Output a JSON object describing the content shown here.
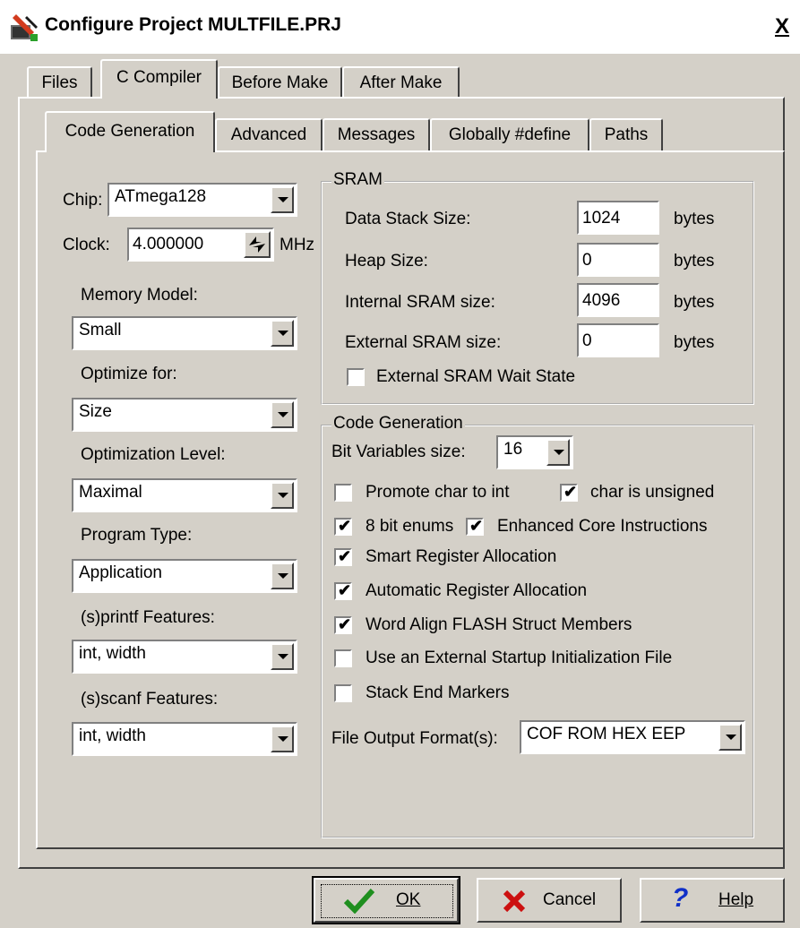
{
  "window": {
    "title": "Configure Project MULTFILE.PRJ",
    "close": "X"
  },
  "tabs": [
    "Files",
    "C Compiler",
    "Before Make",
    "After Make"
  ],
  "subtabs": [
    "Code Generation",
    "Advanced",
    "Messages",
    "Globally #define",
    "Paths"
  ],
  "left": {
    "chip_label": "Chip:",
    "chip_value": "ATmega128",
    "clock_label": "Clock:",
    "clock_value": "4.000000",
    "clock_unit": "MHz",
    "memory_model_label": "Memory Model:",
    "memory_model_value": "Small",
    "optimize_label": "Optimize for:",
    "optimize_value": "Size",
    "opt_level_label": "Optimization Level:",
    "opt_level_value": "Maximal",
    "program_type_label": "Program Type:",
    "program_type_value": "Application",
    "printf_label": "(s)printf Features:",
    "printf_value": "int, width",
    "scanf_label": "(s)scanf Features:",
    "scanf_value": "int, width"
  },
  "sram": {
    "title": "SRAM",
    "rows": [
      {
        "label": "Data Stack Size:",
        "value": "1024",
        "unit": "bytes"
      },
      {
        "label": "Heap Size:",
        "value": "0",
        "unit": "bytes"
      },
      {
        "label": "Internal SRAM size:",
        "value": "4096",
        "unit": "bytes"
      },
      {
        "label": "External SRAM size:",
        "value": "0",
        "unit": "bytes"
      }
    ],
    "wait_state": {
      "label": "External SRAM Wait State",
      "checked": false
    }
  },
  "codegen": {
    "title": "Code Generation",
    "bitvar_label": "Bit Variables size:",
    "bitvar_value": "16",
    "promote_label": "Promote char to int",
    "promote_checked": false,
    "unsigned_label": "char is unsigned",
    "unsigned_checked": true,
    "enums_label": "8 bit enums",
    "enums_checked": true,
    "enhanced_label": "Enhanced Core Instructions",
    "enhanced_checked": true,
    "smart_label": "Smart Register Allocation",
    "smart_checked": true,
    "auto_label": "Automatic Register Allocation",
    "auto_checked": true,
    "word_align_label": "Word Align FLASH Struct Members",
    "word_align_checked": true,
    "startup_label": "Use an External Startup Initialization File",
    "startup_checked": false,
    "stack_end_label": "Stack End Markers",
    "stack_end_checked": false,
    "output_label": "File Output Format(s):",
    "output_value": "COF ROM HEX EEP"
  },
  "buttons": {
    "ok": "OK",
    "cancel": "Cancel",
    "help": "Help"
  },
  "colors": {
    "ok_check": "#1f8f1f",
    "cancel_x": "#cc1010",
    "help_q": "#1030c8"
  }
}
